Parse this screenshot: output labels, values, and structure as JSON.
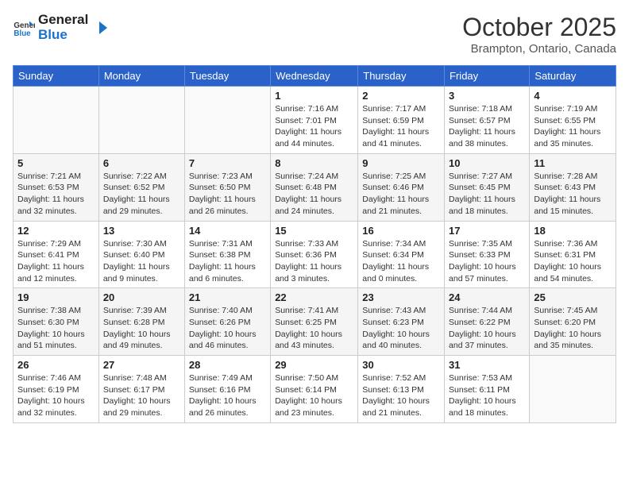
{
  "logo": {
    "line1": "General",
    "line2": "Blue"
  },
  "title": "October 2025",
  "subtitle": "Brampton, Ontario, Canada",
  "days_of_week": [
    "Sunday",
    "Monday",
    "Tuesday",
    "Wednesday",
    "Thursday",
    "Friday",
    "Saturday"
  ],
  "weeks": [
    [
      {
        "day": "",
        "info": ""
      },
      {
        "day": "",
        "info": ""
      },
      {
        "day": "",
        "info": ""
      },
      {
        "day": "1",
        "info": "Sunrise: 7:16 AM\nSunset: 7:01 PM\nDaylight: 11 hours\nand 44 minutes."
      },
      {
        "day": "2",
        "info": "Sunrise: 7:17 AM\nSunset: 6:59 PM\nDaylight: 11 hours\nand 41 minutes."
      },
      {
        "day": "3",
        "info": "Sunrise: 7:18 AM\nSunset: 6:57 PM\nDaylight: 11 hours\nand 38 minutes."
      },
      {
        "day": "4",
        "info": "Sunrise: 7:19 AM\nSunset: 6:55 PM\nDaylight: 11 hours\nand 35 minutes."
      }
    ],
    [
      {
        "day": "5",
        "info": "Sunrise: 7:21 AM\nSunset: 6:53 PM\nDaylight: 11 hours\nand 32 minutes."
      },
      {
        "day": "6",
        "info": "Sunrise: 7:22 AM\nSunset: 6:52 PM\nDaylight: 11 hours\nand 29 minutes."
      },
      {
        "day": "7",
        "info": "Sunrise: 7:23 AM\nSunset: 6:50 PM\nDaylight: 11 hours\nand 26 minutes."
      },
      {
        "day": "8",
        "info": "Sunrise: 7:24 AM\nSunset: 6:48 PM\nDaylight: 11 hours\nand 24 minutes."
      },
      {
        "day": "9",
        "info": "Sunrise: 7:25 AM\nSunset: 6:46 PM\nDaylight: 11 hours\nand 21 minutes."
      },
      {
        "day": "10",
        "info": "Sunrise: 7:27 AM\nSunset: 6:45 PM\nDaylight: 11 hours\nand 18 minutes."
      },
      {
        "day": "11",
        "info": "Sunrise: 7:28 AM\nSunset: 6:43 PM\nDaylight: 11 hours\nand 15 minutes."
      }
    ],
    [
      {
        "day": "12",
        "info": "Sunrise: 7:29 AM\nSunset: 6:41 PM\nDaylight: 11 hours\nand 12 minutes."
      },
      {
        "day": "13",
        "info": "Sunrise: 7:30 AM\nSunset: 6:40 PM\nDaylight: 11 hours\nand 9 minutes."
      },
      {
        "day": "14",
        "info": "Sunrise: 7:31 AM\nSunset: 6:38 PM\nDaylight: 11 hours\nand 6 minutes."
      },
      {
        "day": "15",
        "info": "Sunrise: 7:33 AM\nSunset: 6:36 PM\nDaylight: 11 hours\nand 3 minutes."
      },
      {
        "day": "16",
        "info": "Sunrise: 7:34 AM\nSunset: 6:34 PM\nDaylight: 11 hours\nand 0 minutes."
      },
      {
        "day": "17",
        "info": "Sunrise: 7:35 AM\nSunset: 6:33 PM\nDaylight: 10 hours\nand 57 minutes."
      },
      {
        "day": "18",
        "info": "Sunrise: 7:36 AM\nSunset: 6:31 PM\nDaylight: 10 hours\nand 54 minutes."
      }
    ],
    [
      {
        "day": "19",
        "info": "Sunrise: 7:38 AM\nSunset: 6:30 PM\nDaylight: 10 hours\nand 51 minutes."
      },
      {
        "day": "20",
        "info": "Sunrise: 7:39 AM\nSunset: 6:28 PM\nDaylight: 10 hours\nand 49 minutes."
      },
      {
        "day": "21",
        "info": "Sunrise: 7:40 AM\nSunset: 6:26 PM\nDaylight: 10 hours\nand 46 minutes."
      },
      {
        "day": "22",
        "info": "Sunrise: 7:41 AM\nSunset: 6:25 PM\nDaylight: 10 hours\nand 43 minutes."
      },
      {
        "day": "23",
        "info": "Sunrise: 7:43 AM\nSunset: 6:23 PM\nDaylight: 10 hours\nand 40 minutes."
      },
      {
        "day": "24",
        "info": "Sunrise: 7:44 AM\nSunset: 6:22 PM\nDaylight: 10 hours\nand 37 minutes."
      },
      {
        "day": "25",
        "info": "Sunrise: 7:45 AM\nSunset: 6:20 PM\nDaylight: 10 hours\nand 35 minutes."
      }
    ],
    [
      {
        "day": "26",
        "info": "Sunrise: 7:46 AM\nSunset: 6:19 PM\nDaylight: 10 hours\nand 32 minutes."
      },
      {
        "day": "27",
        "info": "Sunrise: 7:48 AM\nSunset: 6:17 PM\nDaylight: 10 hours\nand 29 minutes."
      },
      {
        "day": "28",
        "info": "Sunrise: 7:49 AM\nSunset: 6:16 PM\nDaylight: 10 hours\nand 26 minutes."
      },
      {
        "day": "29",
        "info": "Sunrise: 7:50 AM\nSunset: 6:14 PM\nDaylight: 10 hours\nand 23 minutes."
      },
      {
        "day": "30",
        "info": "Sunrise: 7:52 AM\nSunset: 6:13 PM\nDaylight: 10 hours\nand 21 minutes."
      },
      {
        "day": "31",
        "info": "Sunrise: 7:53 AM\nSunset: 6:11 PM\nDaylight: 10 hours\nand 18 minutes."
      },
      {
        "day": "",
        "info": ""
      }
    ]
  ]
}
